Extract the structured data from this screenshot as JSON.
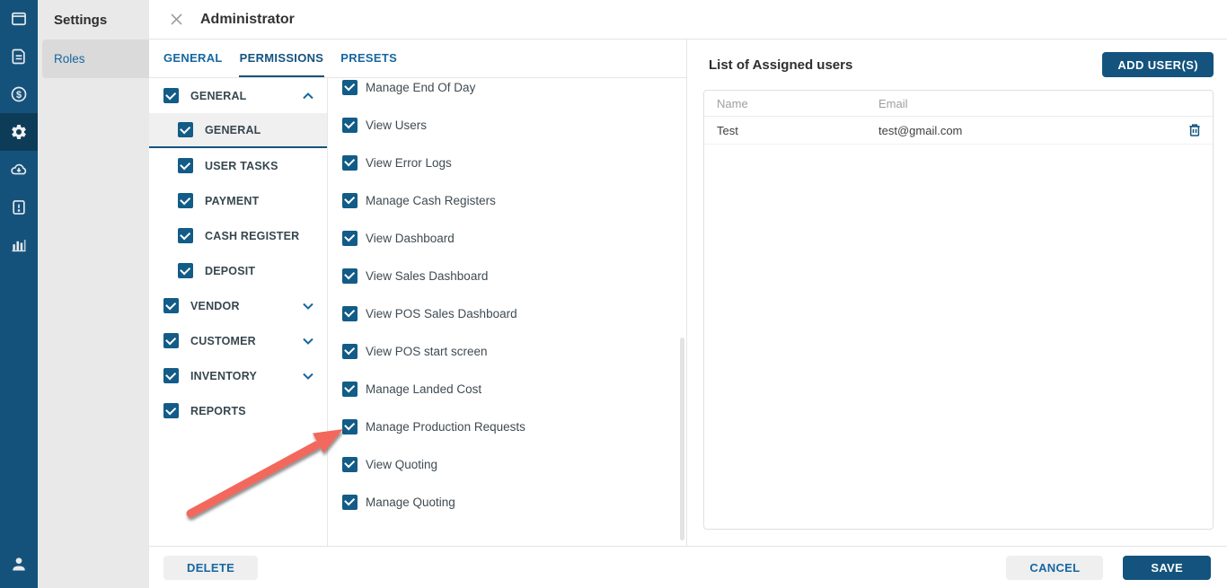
{
  "colors": {
    "sidebar_bg": "#15527B",
    "sidebar_active_bg": "#0D3C59",
    "primary_blue": "#14537E",
    "checkbox_blue": "#125C87",
    "link_blue": "#1667A0",
    "panel_gray": "#E9E9E9",
    "selected_gray": "#DADADA",
    "arrow_red": "#F2685C"
  },
  "sidebar": {
    "icons": [
      "window-icon",
      "document-icon",
      "dollar-icon",
      "settings-gear-icon",
      "cloud-download-icon",
      "card-alert-icon",
      "bar-chart-icon",
      "user-icon"
    ],
    "active_icon": "settings-gear-icon"
  },
  "settings_panel": {
    "title": "Settings",
    "items": [
      {
        "label": "Roles",
        "selected": true
      }
    ]
  },
  "modal": {
    "title": "Administrator",
    "tabs": [
      {
        "label": "GENERAL",
        "active": false
      },
      {
        "label": "PERMISSIONS",
        "active": true
      },
      {
        "label": "PRESETS",
        "active": false
      }
    ],
    "tree": [
      {
        "label": "GENERAL",
        "level": 0,
        "checked": true,
        "chevron": "up"
      },
      {
        "label": "GENERAL",
        "level": 1,
        "checked": true,
        "selected": true
      },
      {
        "label": "USER TASKS",
        "level": 1,
        "checked": true
      },
      {
        "label": "PAYMENT",
        "level": 1,
        "checked": true
      },
      {
        "label": "CASH REGISTER",
        "level": 1,
        "checked": true
      },
      {
        "label": "DEPOSIT",
        "level": 1,
        "checked": true
      },
      {
        "label": "VENDOR",
        "level": 0,
        "checked": true,
        "chevron": "down"
      },
      {
        "label": "CUSTOMER",
        "level": 0,
        "checked": true,
        "chevron": "down"
      },
      {
        "label": "INVENTORY",
        "level": 0,
        "checked": true,
        "chevron": "down"
      },
      {
        "label": "REPORTS",
        "level": 0,
        "checked": true
      }
    ],
    "permissions": [
      {
        "label": "Manage End Of Day",
        "checked": true
      },
      {
        "label": "View Users",
        "checked": true
      },
      {
        "label": "View Error Logs",
        "checked": true
      },
      {
        "label": "Manage Cash Registers",
        "checked": true
      },
      {
        "label": "View Dashboard",
        "checked": true
      },
      {
        "label": "View Sales Dashboard",
        "checked": true
      },
      {
        "label": "View POS Sales Dashboard",
        "checked": true
      },
      {
        "label": "View POS start screen",
        "checked": true
      },
      {
        "label": "Manage Landed Cost",
        "checked": true
      },
      {
        "label": "Manage Production Requests",
        "checked": true,
        "annotated": true
      },
      {
        "label": "View Quoting",
        "checked": true
      },
      {
        "label": "Manage Quoting",
        "checked": true
      }
    ],
    "assigned_users": {
      "heading": "List of Assigned users",
      "add_button": "ADD USER(S)",
      "columns": [
        "Name",
        "Email"
      ],
      "rows": [
        {
          "name": "Test",
          "email": "test@gmail.com"
        }
      ]
    },
    "footer": {
      "delete": "DELETE",
      "cancel": "CANCEL",
      "save": "SAVE"
    }
  }
}
